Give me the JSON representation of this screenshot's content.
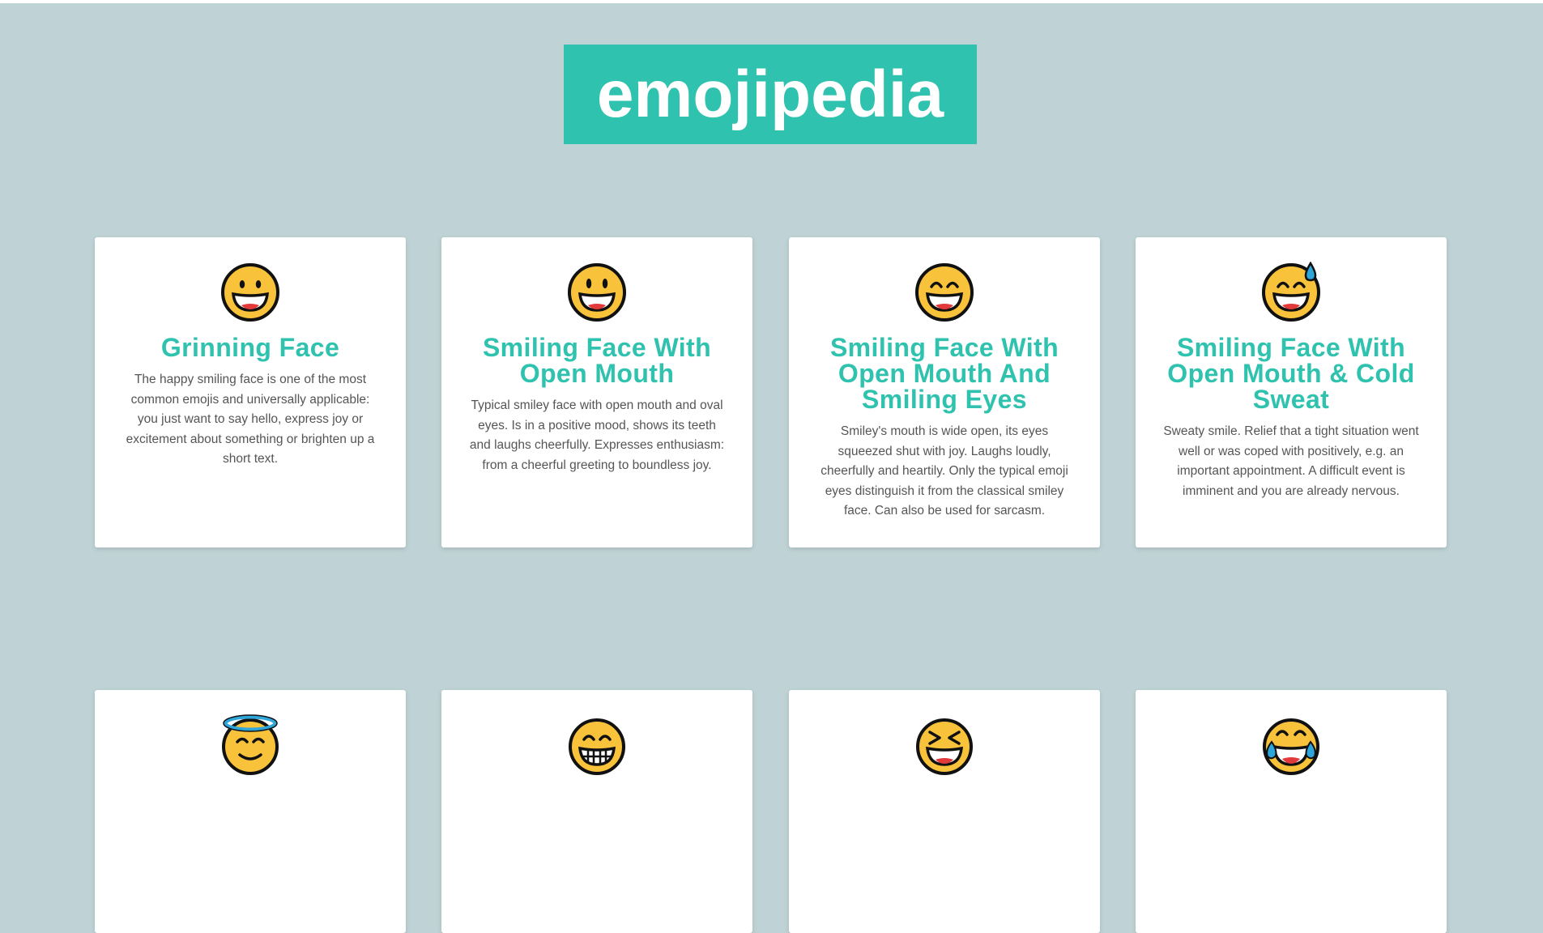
{
  "site": {
    "title": "emojipedia"
  },
  "colors": {
    "background": "#bfd3d6",
    "accent": "#2fc2ae",
    "card": "#ffffff",
    "text": "#555555",
    "emoji_face": "#f8c23b"
  },
  "cards": [
    {
      "icon": "grinning-face-icon",
      "title": "Grinning Face",
      "description": "The happy smiling face is one of the most common emojis and universally applicable: you just want to say hello, express joy or excitement about something or brighten up a short text."
    },
    {
      "icon": "smiling-face-open-mouth-icon",
      "title": "Smiling Face With Open Mouth",
      "description": "Typical smiley face with open mouth and oval eyes. Is in a positive mood, shows its teeth and laughs cheerfully. Expresses enthusiasm: from a cheerful greeting to boundless joy."
    },
    {
      "icon": "smiling-face-open-mouth-smiling-eyes-icon",
      "title": "Smiling Face With Open Mouth And Smiling Eyes",
      "description": "Smiley's mouth is wide open, its eyes squeezed shut with joy. Laughs loudly, cheerfully and heartily. Only the typical emoji eyes distinguish it from the classical smiley face. Can also be used for sarcasm."
    },
    {
      "icon": "smiling-face-cold-sweat-icon",
      "title": "Smiling Face With Open Mouth & Cold Sweat",
      "description": "Sweaty smile. Relief that a tight situation went well or was coped with positively, e.g. an important appointment. A difficult event is imminent and you are already nervous."
    }
  ],
  "cards_row2": [
    {
      "icon": "smiling-face-halo-icon"
    },
    {
      "icon": "grimacing-face-icon"
    },
    {
      "icon": "squinting-laughing-face-icon"
    },
    {
      "icon": "face-with-tears-of-joy-icon"
    }
  ]
}
